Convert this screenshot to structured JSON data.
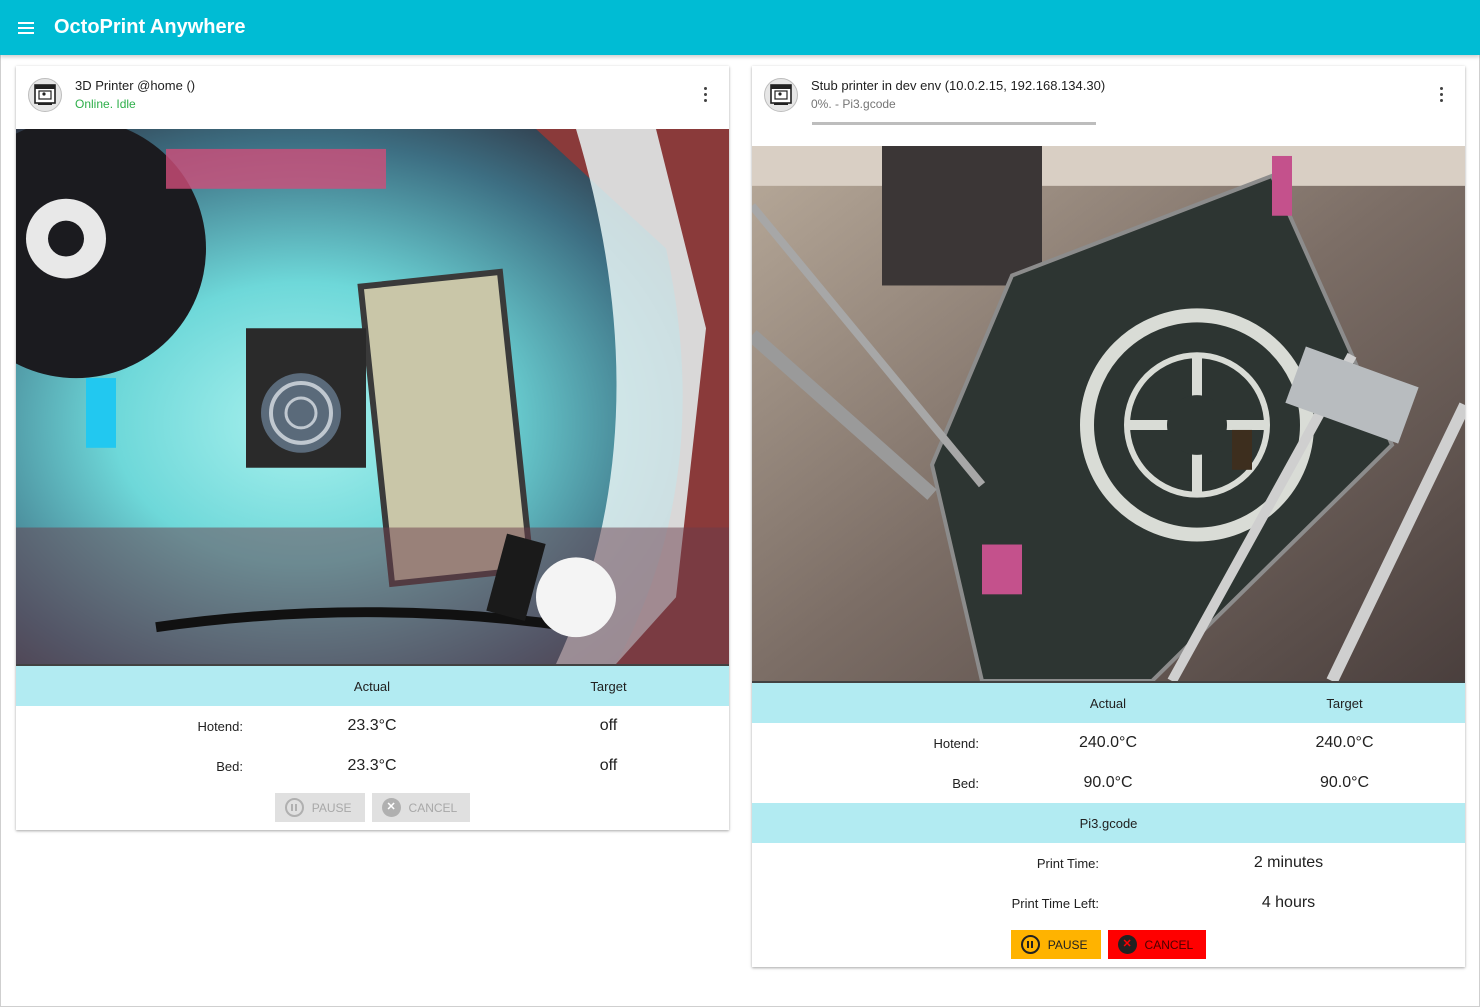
{
  "app": {
    "title": "OctoPrint Anywhere",
    "header_color": "#00bcd4"
  },
  "printers": [
    {
      "name": "3D Printer @home ()",
      "status": "Online. Idle",
      "status_color": "#2eaf4a",
      "table": {
        "col_actual": "Actual",
        "col_target": "Target",
        "hotend_label": "Hotend:",
        "hotend_actual": "23.3°C",
        "hotend_target": "off",
        "bed_label": "Bed:",
        "bed_actual": "23.3°C",
        "bed_target": "off"
      },
      "actions": {
        "pause": "PAUSE",
        "cancel": "CANCEL",
        "enabled": false
      }
    },
    {
      "name": "Stub printer in dev env (10.0.2.15, 192.168.134.30)",
      "status": "0%. - Pi3.gcode",
      "progress": 0,
      "table": {
        "col_actual": "Actual",
        "col_target": "Target",
        "hotend_label": "Hotend:",
        "hotend_actual": "240.0°C",
        "hotend_target": "240.0°C",
        "bed_label": "Bed:",
        "bed_actual": "90.0°C",
        "bed_target": "90.0°C"
      },
      "job": {
        "file": "Pi3.gcode",
        "print_time_label": "Print Time:",
        "print_time": "2 minutes",
        "time_left_label": "Print Time Left:",
        "time_left": "4 hours"
      },
      "actions": {
        "pause": "PAUSE",
        "cancel": "CANCEL",
        "enabled": true
      }
    }
  ]
}
